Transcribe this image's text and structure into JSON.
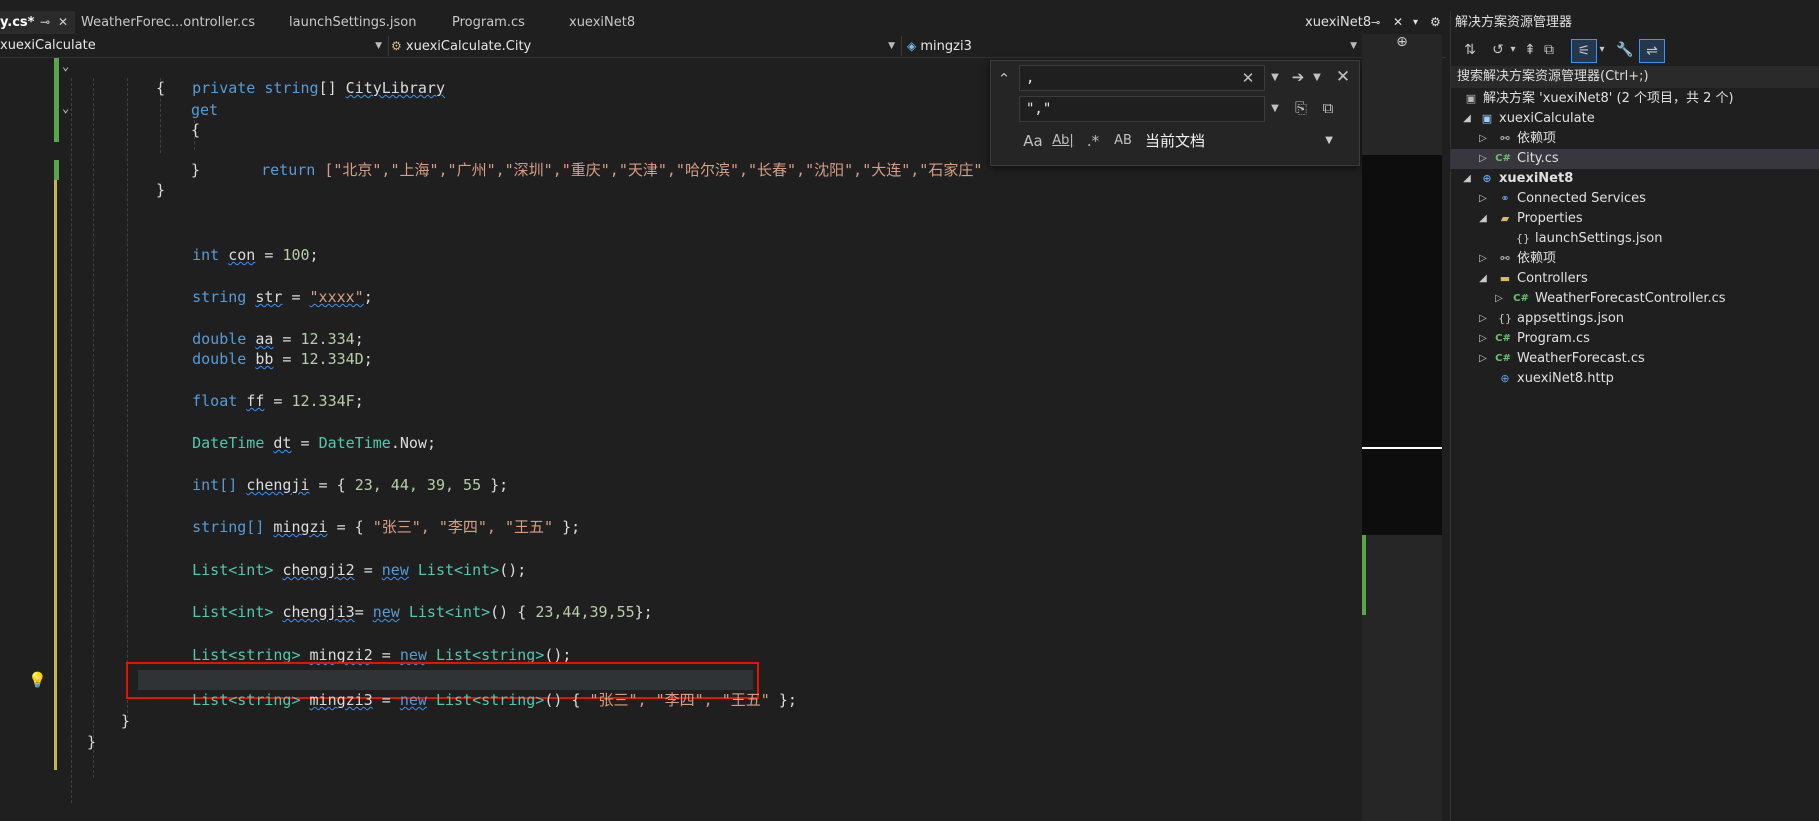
{
  "tabs": [
    {
      "label": "y.cs*",
      "active": true
    },
    {
      "label": "WeatherForec...ontroller.cs",
      "active": false
    },
    {
      "label": "launchSettings.json",
      "active": false
    },
    {
      "label": "Program.cs",
      "active": false
    },
    {
      "label": "xuexiNet8",
      "active": false
    }
  ],
  "right_tab": {
    "label": "xuexiNet8"
  },
  "navbar": {
    "project": "xuexiCalculate",
    "type": "xuexiCalculate.City",
    "member": "mingzi3"
  },
  "find_widget": {
    "find_value": ",",
    "replace_value": "\",\"",
    "scope_label": "当前文档",
    "option_labels": [
      "Aa",
      "Ab|",
      ".*",
      "AB"
    ]
  },
  "code": {
    "line1": {
      "kw": "private string",
      "rest": "[] ",
      "ident": "CityLibrary"
    },
    "brace_open": "{",
    "get_kw": "get",
    "brace_open2": "{",
    "return_kw": "return",
    "return_rest": " [\"北京\",\"上海\",\"广州\",\"深圳\",\"重庆\",\"天津\",\"哈尔滨\",\"长春\",\"沈阳\",\"大连\",\"石家庄\"",
    "brace_close2": "}",
    "brace_close": "}",
    "con": {
      "type": "int",
      "name": "con",
      "mid": " = ",
      "value": "100",
      "end": ";"
    },
    "str": {
      "type": "string",
      "name": "str",
      "mid": " = ",
      "value": "\"xxxx\"",
      "end": ";"
    },
    "aa": {
      "type": "double",
      "name": "aa",
      "mid": " = ",
      "value": "12.334",
      "end": ";"
    },
    "bb": {
      "type": "double",
      "name": "bb",
      "mid": " = ",
      "value": "12.334D",
      "end": ";"
    },
    "ff": {
      "type": "float",
      "name": "ff",
      "mid": " = ",
      "value": "12.334F",
      "end": ";"
    },
    "dt": {
      "type": "DateTime",
      "name": "dt",
      "mid": " = ",
      "value1": "DateTime",
      "value2": ".Now",
      "end": ";"
    },
    "chengji": {
      "type": "int[]",
      "name": "chengji",
      "mid": " = { ",
      "value": "23, 44, 39, 55",
      "end": " };"
    },
    "mingzi": {
      "type": "string[]",
      "name": "mingzi",
      "mid": " = { ",
      "value": "\"张三\", \"李四\", \"王五\"",
      "end": " };"
    },
    "chengji2": {
      "type": "List<int>",
      "name": "chengji2",
      "mid": " = ",
      "new": "new",
      "ctor": " List<int>",
      "end": "();"
    },
    "chengji3": {
      "type": "List<int>",
      "name": "chengji3",
      "mid": "= ",
      "new": "new",
      "ctor": " List<int>",
      "args": "() { ",
      "value": "23,44,39,55",
      "end": "};"
    },
    "mingzi2": {
      "type": "List<string>",
      "name": "mingzi2",
      "mid": " = ",
      "new": "new",
      "ctor": " List<string>",
      "end": "();"
    },
    "mingzi3": {
      "type": "List<string>",
      "name": "mingzi3",
      "mid": " = ",
      "new": "new",
      "ctor": " List<string>",
      "args": "() { ",
      "value": "\"张三\", \"李四\", \"王五\"",
      "end": " };"
    },
    "close_class": "}",
    "close_ns": "}"
  },
  "solution_explorer": {
    "title": "解决方案资源管理器",
    "search_placeholder": "搜索解决方案资源管理器(Ctrl+;)",
    "items": [
      {
        "label": "解决方案 'xuexiNet8' (2 个项目，共 2 个)",
        "icon": "solution-icon"
      },
      {
        "label": "xuexiCalculate",
        "icon": "csproj-icon"
      },
      {
        "label": "依赖项",
        "icon": "dependencies-icon"
      },
      {
        "label": "City.cs",
        "icon": "csharp-file-icon"
      },
      {
        "label": "xuexiNet8",
        "icon": "web-project-icon"
      },
      {
        "label": "Connected Services",
        "icon": "connected-services-icon"
      },
      {
        "label": "Properties",
        "icon": "properties-icon"
      },
      {
        "label": "launchSettings.json",
        "icon": "json-file-icon"
      },
      {
        "label": "依赖项",
        "icon": "dependencies-icon"
      },
      {
        "label": "Controllers",
        "icon": "folder-icon"
      },
      {
        "label": "WeatherForecastController.cs",
        "icon": "csharp-file-icon"
      },
      {
        "label": "appsettings.json",
        "icon": "json-file-icon"
      },
      {
        "label": "Program.cs",
        "icon": "csharp-file-icon"
      },
      {
        "label": "WeatherForecast.cs",
        "icon": "csharp-file-icon"
      },
      {
        "label": "xuexiNet8.http",
        "icon": "http-file-icon"
      }
    ],
    "csharp_badge": "C#"
  },
  "colors": {
    "accent_blue": "#569cd6",
    "type_teal": "#4ec9b0",
    "string_orange": "#d69d85",
    "number_green": "#b5cea8",
    "highlight_red": "#e51400"
  }
}
